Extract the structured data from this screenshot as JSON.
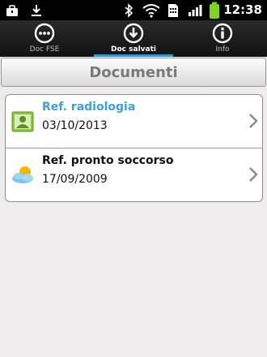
{
  "status_bar": {
    "time": "12:38",
    "icons": [
      "briefcase-icon",
      "download-icon",
      "bluetooth-icon",
      "wifi-icon",
      "sim-icon",
      "signal-icon",
      "battery-icon"
    ]
  },
  "tabs": [
    {
      "label": "Doc FSE",
      "icon": "more-icon",
      "active": false
    },
    {
      "label": "Doc salvati",
      "icon": "download-circle-icon",
      "active": true
    },
    {
      "label": "Info",
      "icon": "info-icon",
      "active": false
    }
  ],
  "header": {
    "title": "Documenti"
  },
  "documents": [
    {
      "title": "Ref. radiologia",
      "date": "03/10/2013",
      "icon": "person-card-icon",
      "highlighted": true
    },
    {
      "title": "Ref. pronto soccorso",
      "date": "17/09/2009",
      "icon": "weather-icon",
      "highlighted": false
    }
  ],
  "colors": {
    "accent": "#1e9be5",
    "highlight_text": "#3e9ee5",
    "background": "#efeced"
  }
}
